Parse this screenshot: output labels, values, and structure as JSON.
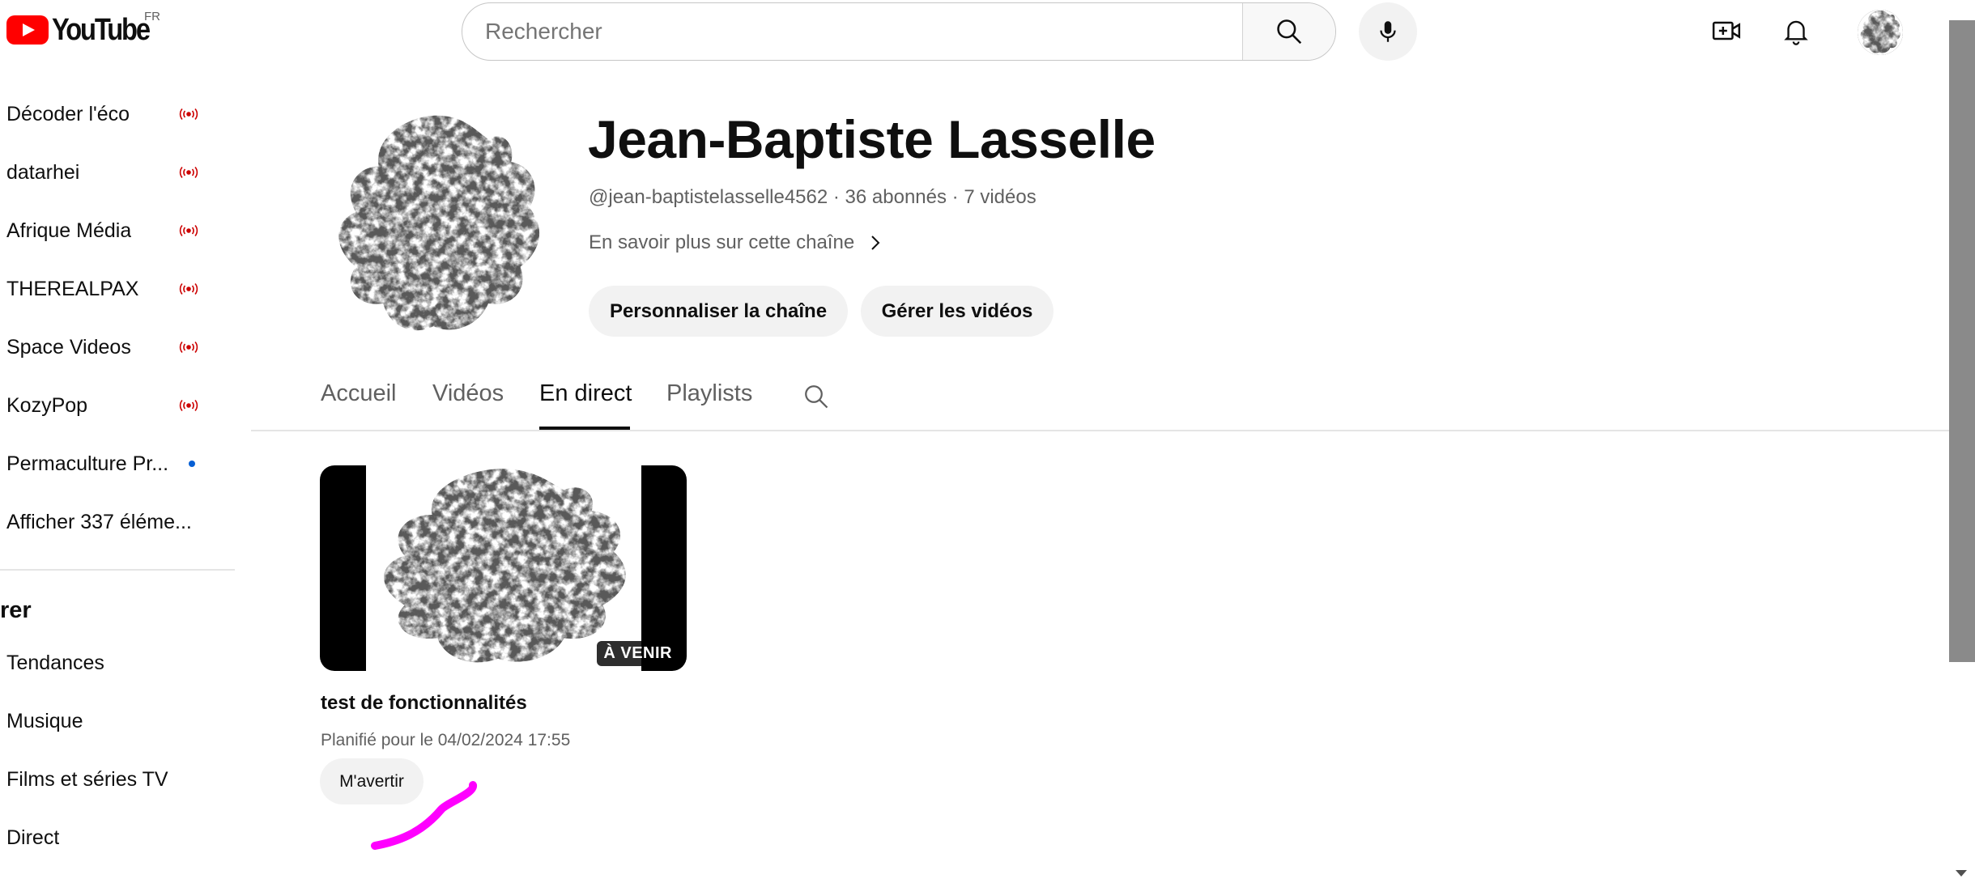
{
  "header": {
    "logo_text": "YouTube",
    "country_code": "FR",
    "search_placeholder": "Rechercher",
    "icons": [
      "search-icon",
      "microphone-icon",
      "create-video-icon",
      "notifications-bell-icon",
      "account-avatar"
    ]
  },
  "sidebar": {
    "subscriptions": [
      {
        "label": "Décoder l'éco",
        "indicator": "live"
      },
      {
        "label": "datarhei",
        "indicator": "live"
      },
      {
        "label": "Afrique Média",
        "indicator": "live"
      },
      {
        "label": "THEREALPAX",
        "indicator": "live"
      },
      {
        "label": "Space Videos",
        "indicator": "live"
      },
      {
        "label": "KozyPop",
        "indicator": "live"
      },
      {
        "label": "Permaculture Pr...",
        "indicator": "new-dot"
      },
      {
        "label": "Afficher 337 éléme...",
        "indicator": "none"
      }
    ],
    "section_title": "rer",
    "explore_items": [
      {
        "label": "Tendances"
      },
      {
        "label": "Musique"
      },
      {
        "label": "Films et séries TV"
      },
      {
        "label": "Direct"
      }
    ]
  },
  "channel": {
    "name": "Jean-Baptiste Lasselle",
    "meta": "@jean-baptistelasselle4562 · 36 abonnés · 7 vidéos",
    "about_link": "En savoir plus sur cette chaîne",
    "customize_button": "Personnaliser la chaîne",
    "manage_button": "Gérer les vidéos"
  },
  "tabs": [
    {
      "label": "Accueil",
      "active": false
    },
    {
      "label": "Vidéos",
      "active": false
    },
    {
      "label": "En direct",
      "active": true
    },
    {
      "label": "Playlists",
      "active": false
    }
  ],
  "video": {
    "badge": "À VENIR",
    "title": "test de fonctionnalités",
    "schedule": "Planifié pour le 04/02/2024 17:55",
    "remind_button": "M'avertir"
  },
  "colors": {
    "brand_red": "#ff0000",
    "live_red": "#cc0000",
    "link_blue": "#065fd4",
    "annotation_magenta": "#ff00ff",
    "pill_bg": "#f2f2f2"
  }
}
